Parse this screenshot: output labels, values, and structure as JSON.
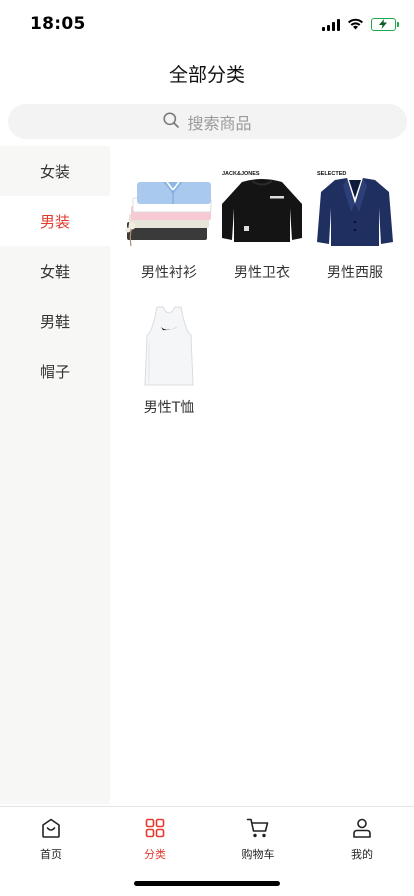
{
  "status_bar": {
    "time": "18:05"
  },
  "header": {
    "title": "全部分类"
  },
  "search": {
    "placeholder": "搜索商品"
  },
  "sidebar": {
    "items": [
      {
        "label": "女装",
        "active": false
      },
      {
        "label": "男装",
        "active": true
      },
      {
        "label": "女鞋",
        "active": false
      },
      {
        "label": "男鞋",
        "active": false
      },
      {
        "label": "帽子",
        "active": false
      }
    ]
  },
  "products": [
    {
      "name": "男性衬衫"
    },
    {
      "name": "男性卫衣",
      "brand": "JACK&JONES"
    },
    {
      "name": "男性西服",
      "brand": "SELECTED"
    },
    {
      "name": "男性T恤"
    }
  ],
  "tabbar": {
    "items": [
      {
        "label": "首页",
        "icon": "home-icon"
      },
      {
        "label": "分类",
        "icon": "category-icon",
        "active": true
      },
      {
        "label": "购物车",
        "icon": "cart-icon"
      },
      {
        "label": "我的",
        "icon": "user-icon"
      }
    ]
  },
  "colors": {
    "accent": "#e23b2e",
    "sidebar_bg": "#f7f7f5",
    "search_bg": "#f3f3f3"
  }
}
